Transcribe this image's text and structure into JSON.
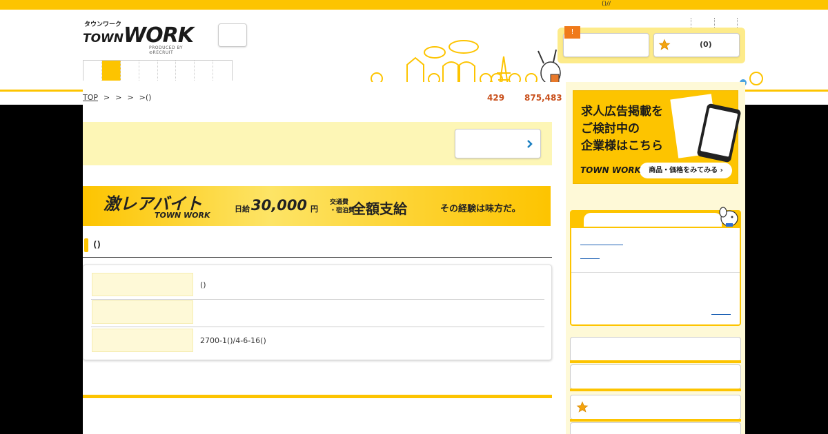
{
  "topbar": {
    "text": "()//"
  },
  "logo": {
    "kana": "タウンワーク",
    "brand_prefix": "TOWN",
    "brand_main": "WORK",
    "produced_by": "PRODUCED BY ⊘RECRUIT"
  },
  "header": {
    "util_links": [
      "",
      ""
    ],
    "history_badge": "!",
    "favorites_label": "(0)"
  },
  "breadcrumb": {
    "top_label": "TOP",
    "separators": [
      ">",
      ">",
      ">",
      ">()"
    ]
  },
  "counts": {
    "new_jobs": "429",
    "total_jobs": "875,483"
  },
  "banner": {
    "title": "激レアバイト",
    "sub_logo": "TOWN WORK",
    "pay_label": "日給",
    "pay_amount": "30,000",
    "pay_unit": "円",
    "transport_line1": "交通費",
    "transport_line2": "・宿泊費",
    "full_pay": "全額支給",
    "tagline": "その経験は味方だ。"
  },
  "section": {
    "title": "()"
  },
  "info_rows": [
    {
      "value": "()"
    },
    {
      "value": ""
    },
    {
      "value": "2700-1()/4-6-16()"
    }
  ],
  "ad": {
    "line1": "求人広告掲載を",
    "line2": "ご検討中の",
    "line3": "企業様はこちら",
    "logo": "TOWN WORK",
    "cta": "商品・価格をみてみる ›"
  },
  "colors": {
    "accent": "#fdc400",
    "count_text": "#c9501c",
    "link": "#1a5fb4"
  }
}
